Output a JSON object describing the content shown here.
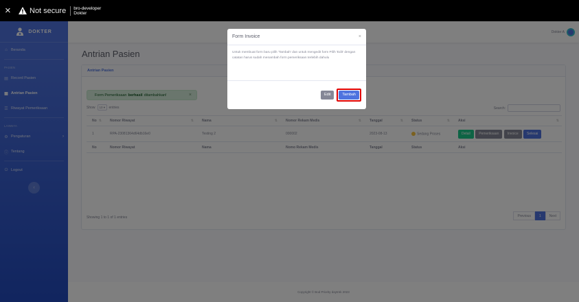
{
  "browser": {
    "close_glyph": "×",
    "security_label": "Not secure",
    "url_line1": "bro-developer",
    "url_line2": "Dokter"
  },
  "sidebar": {
    "brand": "DOKTER",
    "items": [
      {
        "label": "Beranda",
        "icon": "home-icon",
        "glyph": "⌂"
      },
      {
        "heading": "Pasien"
      },
      {
        "label": "Record Pasien",
        "icon": "records-icon",
        "glyph": "▤"
      },
      {
        "label": "Antrian Pasien",
        "icon": "queue-icon",
        "glyph": "▦"
      },
      {
        "label": "Riwayat Pemeriksaan",
        "icon": "history-icon",
        "glyph": "☰"
      },
      {
        "heading": "Lainnya"
      },
      {
        "label": "Pengaturan",
        "icon": "gear-icon",
        "glyph": "⚙"
      },
      {
        "label": "Tentang",
        "icon": "info-icon",
        "glyph": "ⓘ"
      },
      {
        "label": "Logout",
        "icon": "logout-icon",
        "glyph": "⏻"
      }
    ],
    "toggler_glyph": "‹"
  },
  "navbar": {
    "user_name": "Dokter A"
  },
  "main": {
    "page_title": "Antrian Pasien",
    "card_title": "Antrian Pasien",
    "alert": {
      "prefix": "Form Pemeriksaan",
      "bold": "berhasil",
      "suffix": "ditambahkan!",
      "close": "×"
    },
    "show_label_before": "Show",
    "show_value": "10",
    "show_label_after": "entries",
    "search_label": "Search:",
    "table": {
      "headers": [
        "No",
        "Nomor Riwayat",
        "Nama",
        "Nomor Rekam Medis",
        "Tanggal",
        "Status",
        "Aksi"
      ],
      "rows": [
        {
          "no": "1",
          "nomor_riwayat": "RPA-23081364d64db16e0",
          "nama": "Testing 2",
          "nomor_rekam_medis": "000002",
          "tanggal": "2023-08-13",
          "status": "Sedang Proses"
        }
      ],
      "actions": [
        "Detail",
        "Pemeriksaan",
        "Invoice",
        "Selesai"
      ],
      "footer": [
        "No",
        "Nomor Riwayat",
        "Nama",
        "Nomo Rekam Medis",
        "Tanggal",
        "Status",
        "Aksi"
      ]
    },
    "showing_text": "Showing 1 to 1 of 1 entries",
    "pagination": {
      "prev": "Previous",
      "current": "1",
      "next": "Next"
    }
  },
  "footer_text": "Copyright © Bod Priority daytrek 2023",
  "modal": {
    "title": "Form Invoice",
    "close": "×",
    "body": "Untuk membuat form baru pilih 'Tambah' dan untuk mengedit form Pilih 'Edit' dengan catatan harus sudah menambah form pemeriksaan terlebih dahulu",
    "edit_label": "Edit",
    "tambah_label": "Tambah"
  },
  "colors": {
    "primary": "#4e73df",
    "success": "#1cc88a",
    "secondary": "#858796",
    "warning": "#f6c23e",
    "highlight": "#e00000"
  }
}
